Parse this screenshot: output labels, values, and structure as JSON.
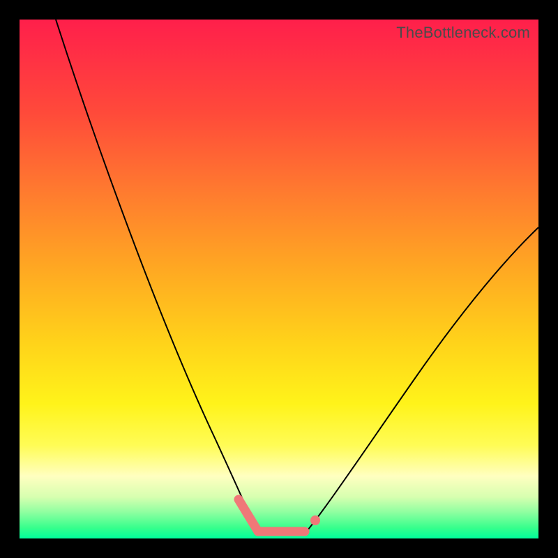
{
  "watermark": "TheBottleneck.com",
  "chart_data": {
    "type": "line",
    "title": "",
    "xlabel": "",
    "ylabel": "",
    "xlim": [
      0,
      100
    ],
    "ylim": [
      0,
      100
    ],
    "grid": false,
    "series": [
      {
        "name": "left-curve",
        "x": [
          7,
          12,
          18,
          24,
          30,
          36,
          40,
          44,
          46
        ],
        "values": [
          100,
          85,
          68,
          52,
          36,
          21,
          11,
          4,
          0
        ]
      },
      {
        "name": "flat-region",
        "x": [
          46,
          49,
          52,
          55
        ],
        "values": [
          0,
          0,
          0,
          0
        ]
      },
      {
        "name": "right-curve",
        "x": [
          55,
          60,
          66,
          74,
          82,
          90,
          100
        ],
        "values": [
          0,
          6,
          14,
          26,
          38,
          48,
          60
        ]
      }
    ],
    "markers": {
      "left_slanted": {
        "x": [
          42,
          46
        ],
        "y": [
          7,
          1
        ]
      },
      "flat": {
        "x": [
          46,
          55
        ],
        "y": [
          1,
          1
        ]
      },
      "right_dot": {
        "x": 57,
        "y": 3
      }
    },
    "background_gradient": [
      "#ff1f4b",
      "#ffd21a",
      "#00ff9c"
    ]
  }
}
